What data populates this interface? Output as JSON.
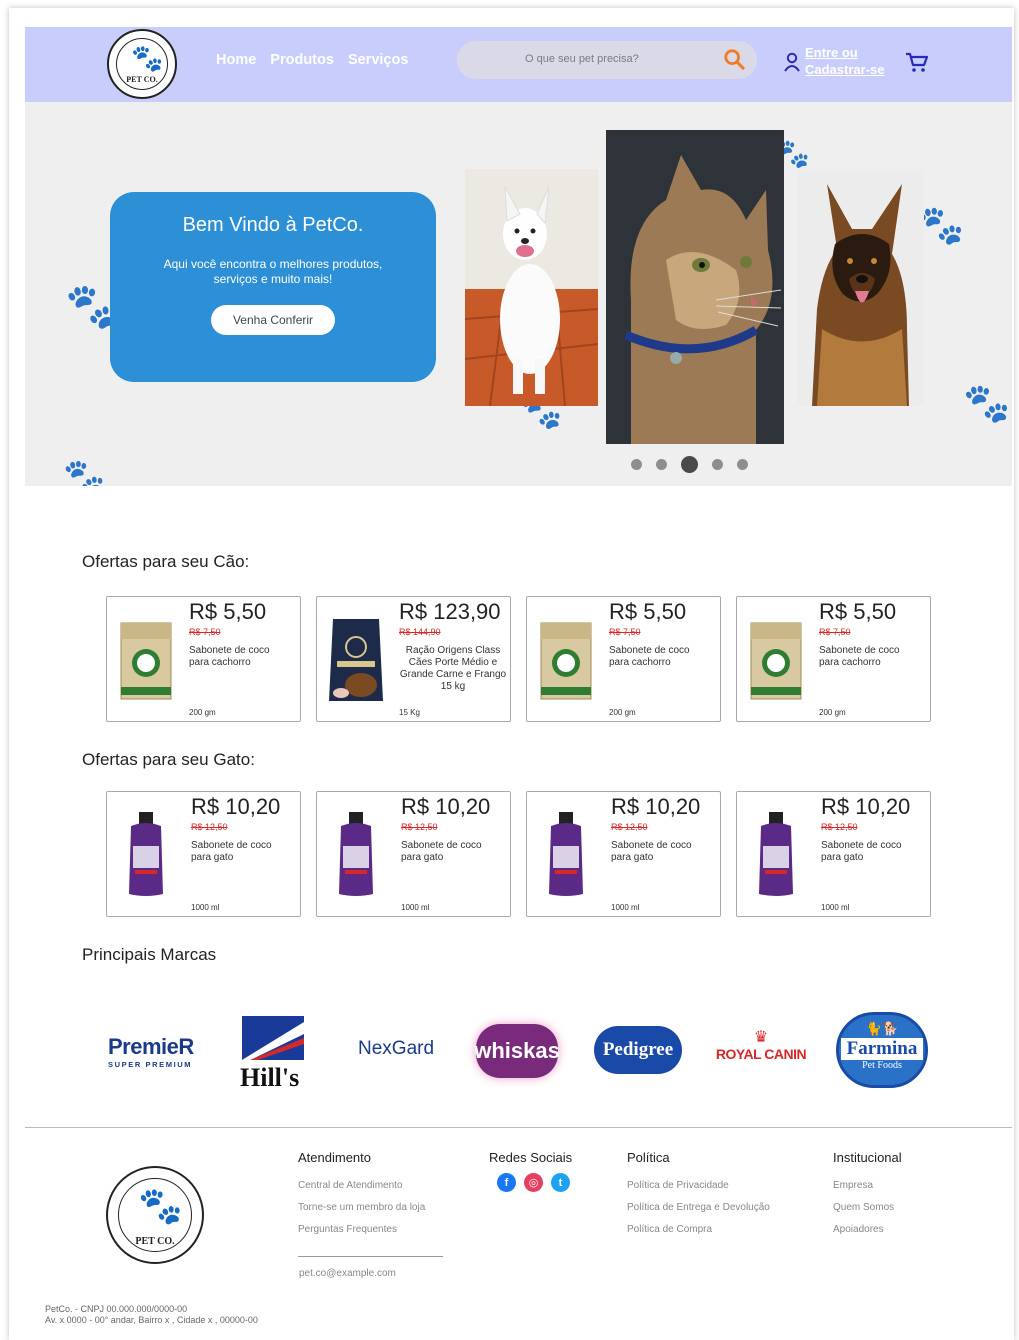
{
  "header": {
    "logo_text": "PET CO.",
    "nav": [
      "Home",
      "Produtos",
      "Serviços"
    ],
    "search_placeholder": "O que seu pet precisa?",
    "login_line1": "Entre ou",
    "login_line2": "Cadastrar-se"
  },
  "hero": {
    "title": "Bem Vindo à PetCo.",
    "subtitle": "Aqui você encontra o melhores produtos,  serviços e muito mais!",
    "cta": "Venha Conferir",
    "slides": 5,
    "active_slide": 3
  },
  "dog_offers": {
    "title": "Ofertas para seu Cão:",
    "items": [
      {
        "price": "R$ 5,50",
        "old_price": "R$ 7,50",
        "desc": "Sabonete de coco para cachorro",
        "size": "200 gm"
      },
      {
        "price": "R$ 123,90",
        "old_price": "R$ 144,90",
        "desc": "Ração Origens Class Cães Porte Médio e Grande Carne e Frango 15 kg",
        "size": "15 Kg"
      },
      {
        "price": "R$ 5,50",
        "old_price": "R$ 7,50",
        "desc": "Sabonete de coco para cachorro",
        "size": "200 gm"
      },
      {
        "price": "R$ 5,50",
        "old_price": "R$ 7,50",
        "desc": "Sabonete de coco para cachorro",
        "size": "200 gm"
      }
    ]
  },
  "cat_offers": {
    "title": "Ofertas para seu Gato:",
    "items": [
      {
        "price": "R$ 10,20",
        "old_price": "R$ 12,50",
        "desc": "Sabonete de coco para gato",
        "size": "1000 ml"
      },
      {
        "price": "R$ 10,20",
        "old_price": "R$ 12,50",
        "desc": "Sabonete de coco para gato",
        "size": "1000 ml"
      },
      {
        "price": "R$ 10,20",
        "old_price": "R$ 12,50",
        "desc": "Sabonete de coco para gato",
        "size": "1000 ml"
      },
      {
        "price": "R$ 10,20",
        "old_price": "R$ 12,50",
        "desc": "Sabonete de coco para gato",
        "size": "1000 ml"
      }
    ]
  },
  "brands": {
    "title": "Principais Marcas",
    "items": [
      "PremieR",
      "SUPER PREMIUM",
      "Hill's",
      "NexGard",
      "whiskas",
      "Pedigree",
      "ROYAL CANIN",
      "Farmina",
      "Pet Foods"
    ]
  },
  "footer": {
    "logo_text": "PET CO.",
    "atendimento": {
      "title": "Atendimento",
      "links": [
        "Central de Atendimento",
        "Torne-se um membro da loja",
        "Perguntas Frequentes"
      ],
      "email": "pet.co@example.com"
    },
    "redes": {
      "title": "Redes Sociais"
    },
    "politica": {
      "title": "Política",
      "links": [
        "Política de Privacidade",
        "Política de Entrega e Devolução",
        "Política de Compra"
      ]
    },
    "institucional": {
      "title": "Institucional",
      "links": [
        "Empresa",
        "Quem Somos",
        "Apoiadores"
      ]
    },
    "address_line1": "PetCo. - CNPJ 00.000.000/0000-00",
    "address_line2": "Av. x 0000 - 00° andar, Bairro x , Cidade x , 00000-00"
  },
  "colors": {
    "header": "#c8cdfb",
    "hero_card": "#2d8fd5",
    "search_icon": "#f07b22",
    "cart_icon": "#2a2ab8",
    "old_price": "#d62828"
  }
}
